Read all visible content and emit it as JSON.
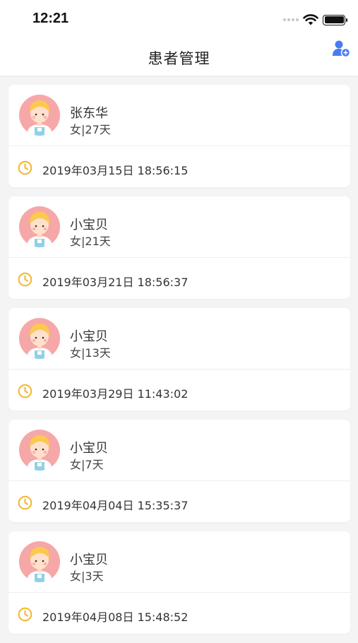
{
  "status_bar": {
    "time": "12:21"
  },
  "header": {
    "title": "患者管理",
    "add_icon": "add-user-icon"
  },
  "colors": {
    "accent": "#4a7cf0",
    "clock": "#f5b52a",
    "avatar_bg": "#f6a7a7"
  },
  "patients": [
    {
      "name": "张东华",
      "info": "女|27天",
      "time": "2019年03月15日 18:56:15"
    },
    {
      "name": "小宝贝",
      "info": "女|21天",
      "time": "2019年03月21日 18:56:37"
    },
    {
      "name": "小宝贝",
      "info": "女|13天",
      "time": "2019年03月29日 11:43:02"
    },
    {
      "name": "小宝贝",
      "info": "女|7天",
      "time": "2019年04月04日 15:35:37"
    },
    {
      "name": "小宝贝",
      "info": "女|3天",
      "time": "2019年04月08日 15:48:52"
    }
  ]
}
